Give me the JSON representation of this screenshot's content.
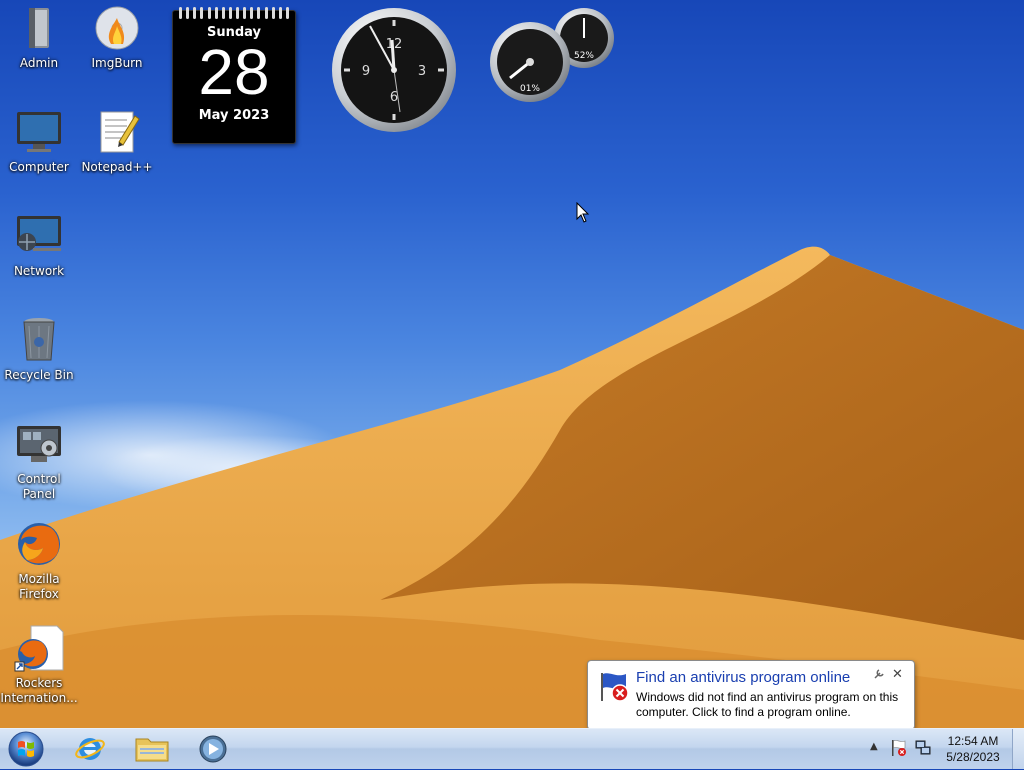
{
  "desktop_icons": [
    {
      "label": "Admin",
      "icon": "user-folder-icon"
    },
    {
      "label": "ImgBurn",
      "icon": "imgburn-disc-icon"
    },
    {
      "label": "Computer",
      "icon": "computer-monitor-icon"
    },
    {
      "label": "Notepad++",
      "icon": "notepad-plus-icon"
    },
    {
      "label": "Network",
      "icon": "network-icon"
    },
    {
      "label": "Recycle Bin",
      "icon": "recycle-bin-icon"
    },
    {
      "label": "Control Panel",
      "icon": "control-panel-icon"
    },
    {
      "label": "Mozilla Firefox",
      "icon": "firefox-icon"
    },
    {
      "label": "Rockers Internation...",
      "icon": "firefox-shortcut-file-icon"
    }
  ],
  "calendar_gadget": {
    "weekday": "Sunday",
    "day": "28",
    "month_year": "May 2023"
  },
  "clock_gadget": {
    "numerals": [
      "12",
      "3",
      "6",
      "9"
    ]
  },
  "cpu_meter_gadget": {
    "cpu": "01%",
    "memory": "52%"
  },
  "notification": {
    "title": "Find an antivirus program online",
    "message": "Windows did not find an antivirus program on this computer. Click to find a program online.",
    "icon": "action-center-flag-error-icon",
    "options_icon": "wrench-icon",
    "close_label": "✕"
  },
  "taskbar": {
    "start_icon": "windows-orb-icon",
    "pinned": [
      {
        "icon": "internet-explorer-icon"
      },
      {
        "icon": "windows-explorer-folder-icon"
      },
      {
        "icon": "windows-media-player-icon"
      }
    ],
    "tray": {
      "overflow_icon": "show-hidden-icons-chevron",
      "action_center_icon": "action-center-flag-icon",
      "network_icon": "network-tray-icon",
      "time": "12:54 AM",
      "date": "5/28/2023"
    }
  },
  "colors": {
    "sky_top": "#1747b8",
    "dune_light": "#e9a74a",
    "dune_shadow": "#b56d1d",
    "taskbar": "#c3d6ee",
    "balloon_title": "#1a3fb0"
  }
}
